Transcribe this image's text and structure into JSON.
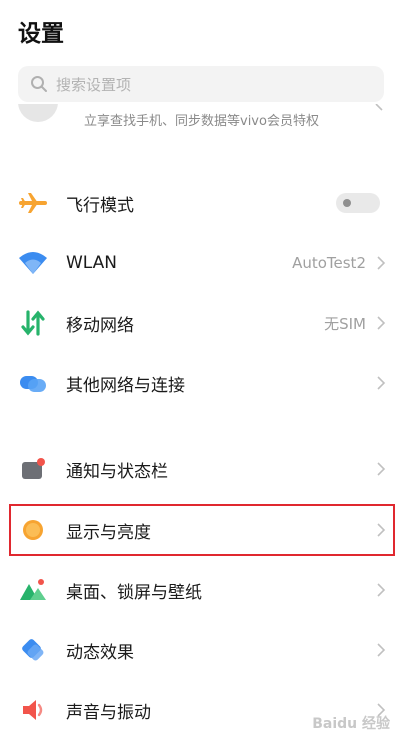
{
  "header": {
    "title": "设置"
  },
  "search": {
    "placeholder": "搜索设置项"
  },
  "account": {
    "subtitle": "立享查找手机、同步数据等vivo会员特权"
  },
  "group1": [
    {
      "label": "飞行模式",
      "icon": "airplane-icon",
      "control": "toggle",
      "toggle_state": "off"
    },
    {
      "label": "WLAN",
      "icon": "wifi-icon",
      "value": "AutoTest2"
    },
    {
      "label": "移动网络",
      "icon": "mobile-data-icon",
      "value": "无SIM"
    },
    {
      "label": "其他网络与连接",
      "icon": "cloud-link-icon"
    }
  ],
  "group2": [
    {
      "label": "通知与状态栏",
      "icon": "notification-icon"
    },
    {
      "label": "显示与亮度",
      "icon": "brightness-icon",
      "highlighted": true
    },
    {
      "label": "桌面、锁屏与壁纸",
      "icon": "wallpaper-icon"
    },
    {
      "label": "动态效果",
      "icon": "dynamic-effect-icon"
    },
    {
      "label": "声音与振动",
      "icon": "sound-icon"
    }
  ],
  "watermark": "Baidu 经验",
  "colors": {
    "highlight_border": "#e0282f",
    "accent_orange": "#f7a431",
    "accent_blue": "#3b8cf0",
    "accent_green": "#27b36b"
  }
}
